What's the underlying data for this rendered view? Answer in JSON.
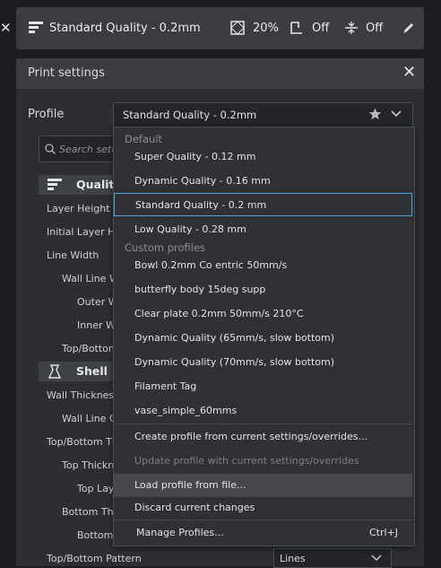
{
  "header": {
    "quality": "Standard Quality - 0.2mm",
    "infill": "20%",
    "support": "Off",
    "adhesion": "Off"
  },
  "panel": {
    "title": "Print settings",
    "profile_label": "Profile",
    "profile_value": "Standard Quality - 0.2mm",
    "search_placeholder": "Search setti"
  },
  "categories": [
    {
      "label": "Qualit",
      "icon": "quality-icon"
    },
    {
      "label": "Shell",
      "icon": "shell-icon"
    }
  ],
  "settings": {
    "layer_height": "Layer Height",
    "initial_layer": "Initial Layer H",
    "line_width": "Line Width",
    "wall_line": "Wall Line W",
    "outer": "Outer W",
    "inner": "Inner W",
    "topbottom_line": "Top/Botton",
    "wall_thickness": "Wall Thickness",
    "wall_line_count": "Wall Line C",
    "topbottom_thickness": "Top/Bottom Th",
    "top_thickness": "Top Thickn",
    "top_layers": "Top Lay",
    "bottom_thickness": "Bottom Th",
    "bottom": "Bottom",
    "topbottom_pattern": "Top/Bottom Pattern",
    "topbottom_pattern_value": "Lines"
  },
  "dropdown": {
    "default_header": "Default",
    "default_profiles": [
      "Super Quality - 0.12 mm",
      "Dynamic Quality - 0.16 mm",
      "Standard Quality - 0.2 mm",
      "Low Quality - 0.28 mm"
    ],
    "custom_header": "Custom profiles",
    "custom_profiles": [
      "Bowl 0.2mm Co     entric 50mm/s",
      "butterfly body 15deg supp",
      "Clear plate 0.2mm 50mm/s 210°C",
      "Dynamic Quality (65mm/s, slow bottom)",
      "Dynamic Quality (70mm/s, slow bottom)",
      "Filament Tag",
      "vase_simple_60mms"
    ],
    "actions": {
      "create": "Create profile from current settings/overrides...",
      "update": "Update profile with current settings/overrides",
      "load": "Load profile from file...",
      "discard": "Discard current changes",
      "manage": "Manage Profiles...",
      "manage_shortcut": "Ctrl+J"
    }
  }
}
